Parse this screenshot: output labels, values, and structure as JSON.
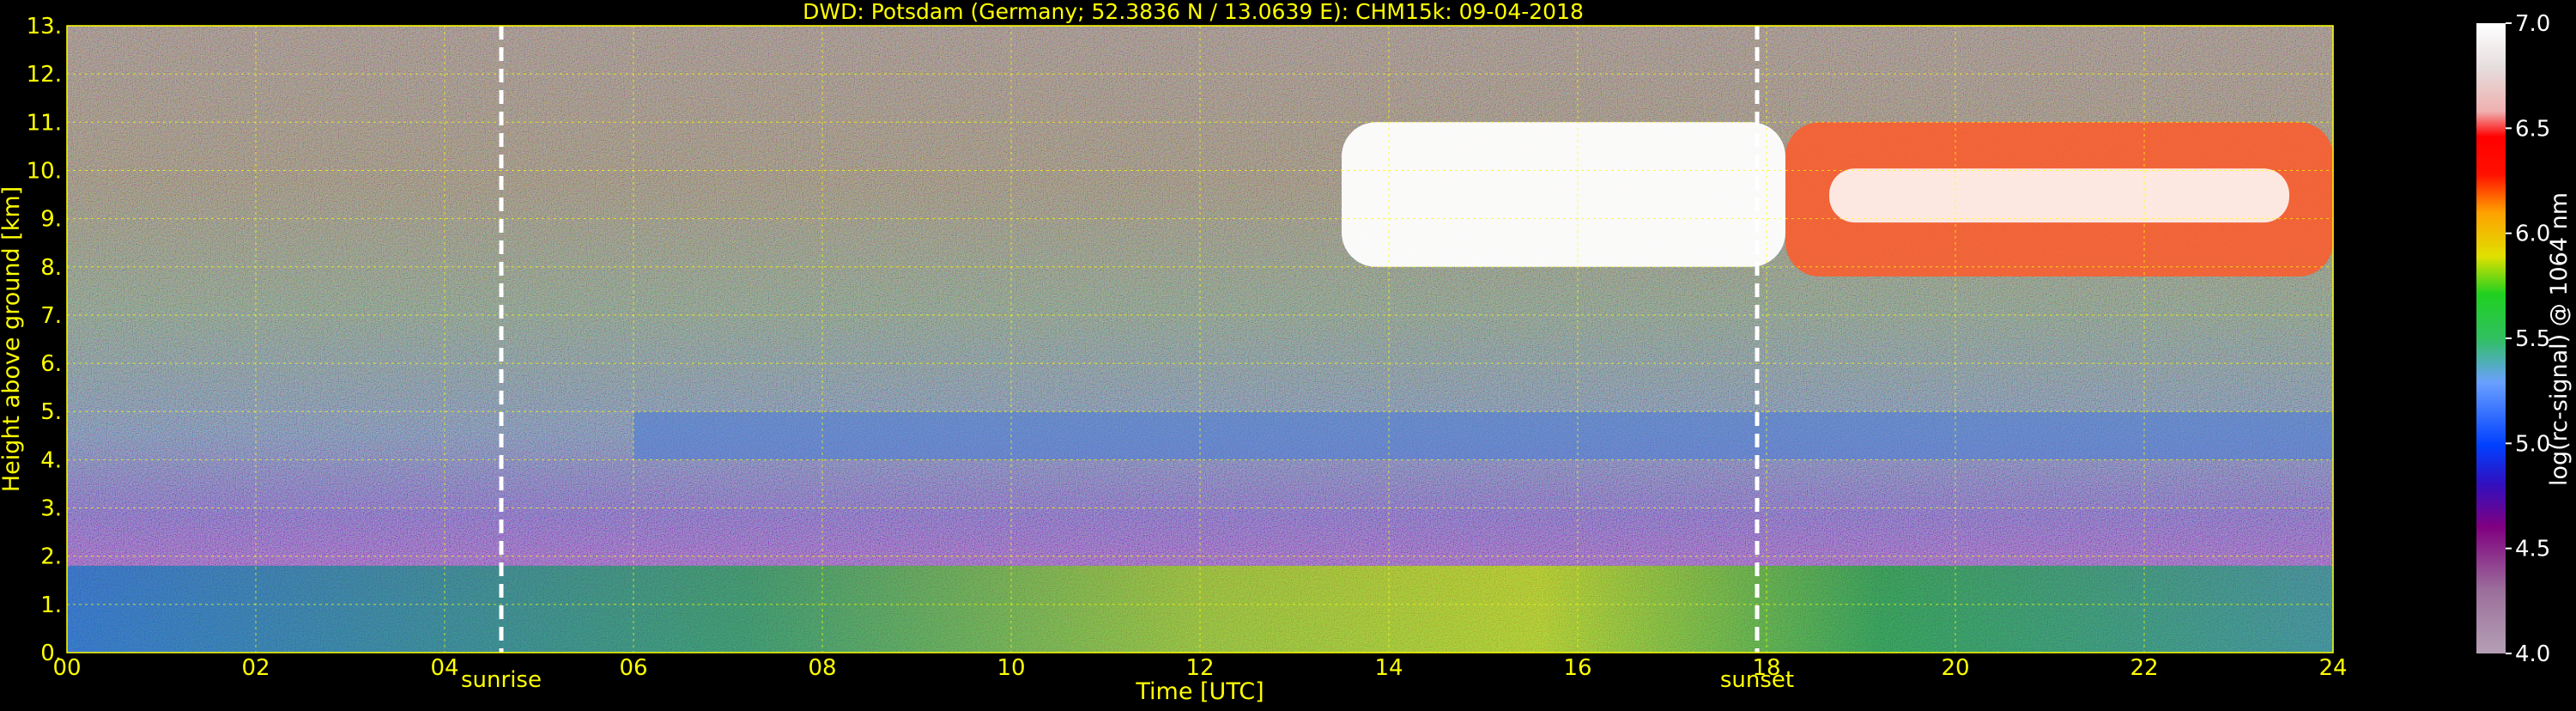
{
  "chart_data": {
    "type": "heatmap",
    "title": "DWD: Potsdam (Germany; 52.3836 N / 13.0639 E):    CHM15k: 09-04-2018",
    "xlabel": "Time [UTC]",
    "ylabel": "Height above ground [km]",
    "xlim": [
      0,
      24
    ],
    "ylim": [
      0,
      13
    ],
    "x_ticks": [
      "00",
      "02",
      "04",
      "06",
      "08",
      "10",
      "12",
      "14",
      "16",
      "18",
      "20",
      "22",
      "24"
    ],
    "y_ticks": [
      "0.",
      "1.",
      "2.",
      "3.",
      "4.",
      "5.",
      "6.",
      "7.",
      "8.",
      "9.",
      "10.",
      "11.",
      "12.",
      "13."
    ],
    "grid": true,
    "annotations": [
      {
        "label": "sunrise",
        "x": 4.6
      },
      {
        "label": "sunset",
        "x": 17.9
      }
    ],
    "colorbar": {
      "label": "log(rc-signal) @ 1064 nm",
      "range": [
        4.0,
        7.0
      ],
      "ticks": [
        "4.0",
        "4.5",
        "5.0",
        "5.5",
        "6.0",
        "6.5",
        "7.0"
      ]
    },
    "features": [
      {
        "name": "boundary layer high signal",
        "x": [
          0,
          24
        ],
        "height_km": [
          0,
          1.8
        ],
        "log_signal": 5.5
      },
      {
        "name": "aerosol layer",
        "x": [
          6,
          24
        ],
        "height_km": [
          4.0,
          5.0
        ],
        "log_signal": 5.3
      },
      {
        "name": "cirrus cloud",
        "x": [
          13.5,
          18.2
        ],
        "height_km": [
          8.0,
          11.0
        ],
        "log_signal": 7.0
      },
      {
        "name": "cirrus cloud",
        "x": [
          18.2,
          24
        ],
        "height_km": [
          7.8,
          11.0
        ],
        "log_signal": 6.3
      }
    ]
  },
  "colors": {
    "axis": "#ffff00",
    "grid": "#ffff00",
    "background": "#000000",
    "colormap": [
      "#b5a0b5",
      "#9b6f9b",
      "#800080",
      "#4000c0",
      "#0040ff",
      "#6aa0ff",
      "#30c060",
      "#20d020",
      "#e0e000",
      "#ffa000",
      "#ff3000",
      "#ff0000",
      "#f0b0b0",
      "#ffffff"
    ]
  }
}
